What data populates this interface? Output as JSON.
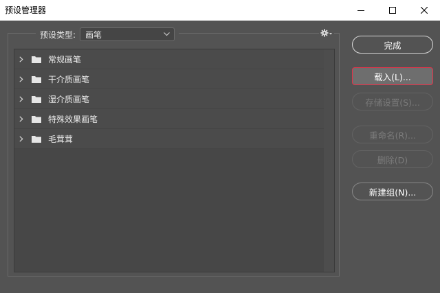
{
  "window": {
    "title": "预设管理器"
  },
  "preset_type": {
    "label": "预设类型:",
    "value": "画笔"
  },
  "list": {
    "items": [
      {
        "label": "常规画笔"
      },
      {
        "label": "干介质画笔"
      },
      {
        "label": "湿介质画笔"
      },
      {
        "label": "特殊效果画笔"
      },
      {
        "label": "毛茸茸"
      }
    ]
  },
  "buttons": {
    "done": "完成",
    "load": "载入(L)...",
    "save": "存储设置(S)...",
    "rename": "重命名(R)...",
    "delete": "删除(D)",
    "new_group": "新建组(N)..."
  },
  "icons": {
    "minimize": "minimize-icon",
    "maximize": "maximize-icon",
    "close": "close-icon",
    "gear": "gear-icon",
    "chevron": "chevron-right-icon",
    "folder": "folder-icon"
  },
  "colors": {
    "focus_border": "#e0344a",
    "background": "#535353"
  }
}
